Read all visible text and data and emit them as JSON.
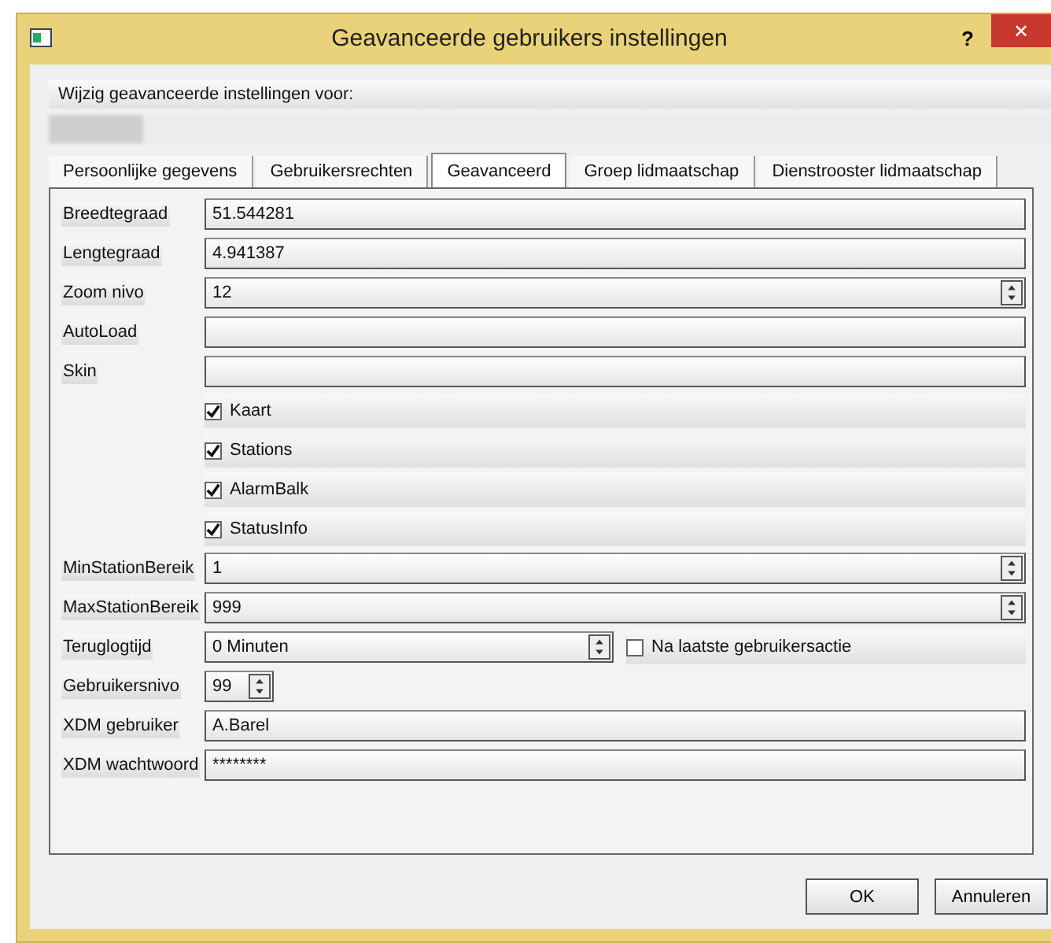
{
  "window": {
    "title": "Geavanceerde gebruikers instellingen",
    "help": "?",
    "close": "✕"
  },
  "header": {
    "label": "Wijzig geavanceerde instellingen voor:"
  },
  "tabs": [
    {
      "label": "Persoonlijke gegevens",
      "selected": false
    },
    {
      "label": "Gebruikersrechten",
      "selected": false
    },
    {
      "label": "Geavanceerd",
      "selected": true
    },
    {
      "label": "Groep lidmaatschap",
      "selected": false
    },
    {
      "label": "Dienstrooster lidmaatschap",
      "selected": false
    }
  ],
  "rows": [
    {
      "kind": "text",
      "label": "Breedtegraad",
      "value": "51.544281"
    },
    {
      "kind": "text",
      "label": "Lengtegraad",
      "value": "4.941387"
    },
    {
      "kind": "spin",
      "label": "Zoom nivo",
      "value": "12"
    },
    {
      "kind": "text",
      "label": "AutoLoad"
    },
    {
      "kind": "text",
      "label": "Skin"
    },
    {
      "kind": "check",
      "label": "Kaart",
      "checked": true
    },
    {
      "kind": "check",
      "label": "Stations",
      "checked": true
    },
    {
      "kind": "check",
      "label": "AlarmBalk",
      "checked": true
    },
    {
      "kind": "check",
      "label": "StatusInfo",
      "checked": true
    },
    {
      "kind": "spin",
      "label": "MinStationBereik",
      "value": "1"
    },
    {
      "kind": "spin",
      "label": "MaxStationBereik",
      "value": "999"
    },
    {
      "kind": "spin_check",
      "label": "Teruglogtijd",
      "value": "0 Minuten",
      "check_label": "Na laatste gebruikersactie",
      "checked": false
    },
    {
      "kind": "small_spin",
      "label": "Gebruikersnivo",
      "value": "99"
    },
    {
      "kind": "text",
      "label": "XDM gebruiker",
      "value": "A.Barel"
    },
    {
      "kind": "text",
      "label": "XDM wachtwoord",
      "value": "********"
    }
  ],
  "buttons": [
    "OK",
    "Annuleren"
  ]
}
